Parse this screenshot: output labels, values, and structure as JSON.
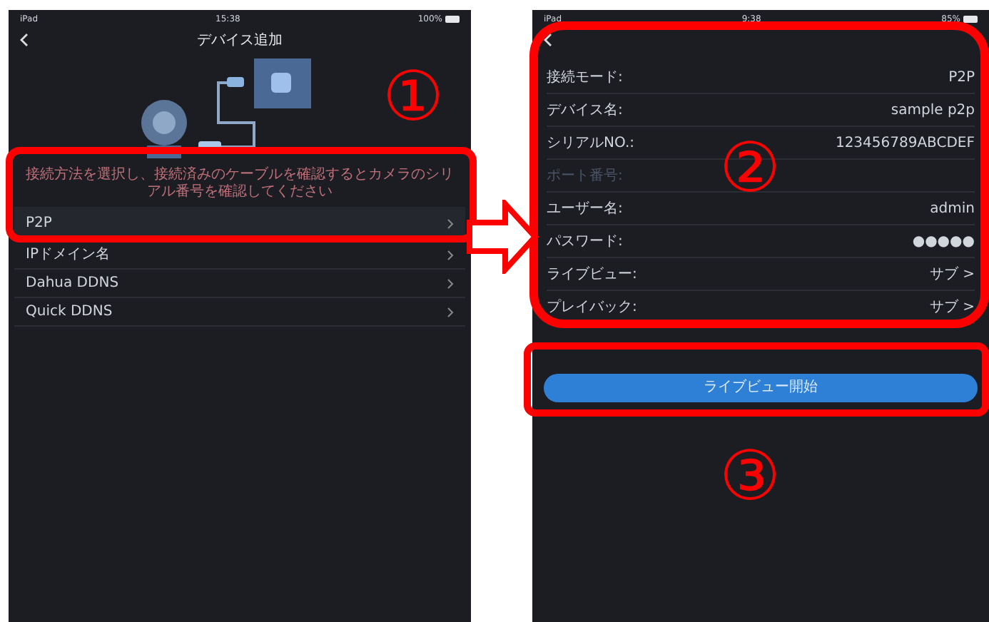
{
  "left_screen": {
    "status_bar": {
      "carrier": "iPad",
      "time": "15:38",
      "battery": "100%"
    },
    "title": "デバイス追加",
    "hint": "接続方法を選択し、接続済みのケーブルを確認するとカメラのシリアル番号を確認してください",
    "options": [
      {
        "label": "P2P",
        "selected": true
      },
      {
        "label": "IPドメイン名",
        "selected": false
      },
      {
        "label": "Dahua DDNS",
        "selected": false
      },
      {
        "label": "Quick DDNS",
        "selected": false
      }
    ]
  },
  "right_screen": {
    "status_bar": {
      "carrier": "iPad",
      "time": "9:38",
      "battery": "85%"
    },
    "fields": [
      {
        "label": "接続モード:",
        "value": "P2P",
        "disabled": false
      },
      {
        "label": "デバイス名:",
        "value": "sample p2p",
        "disabled": false
      },
      {
        "label": "シリアルNO.:",
        "value": "123456789ABCDEF",
        "disabled": false
      },
      {
        "label": "ポート番号:",
        "disabled": true
      },
      {
        "label": "ユーザー名:",
        "value": "admin",
        "disabled": false
      },
      {
        "label": "パスワード:",
        "value": "●●●●●",
        "disabled": false
      },
      {
        "label": "ライブビュー:",
        "value": "サブ >",
        "disabled": false
      },
      {
        "label": "プレイバック:",
        "value": "サブ >",
        "disabled": false
      }
    ],
    "button": "ライブビュー開始"
  },
  "annotations": [
    "①",
    "②",
    "③"
  ]
}
